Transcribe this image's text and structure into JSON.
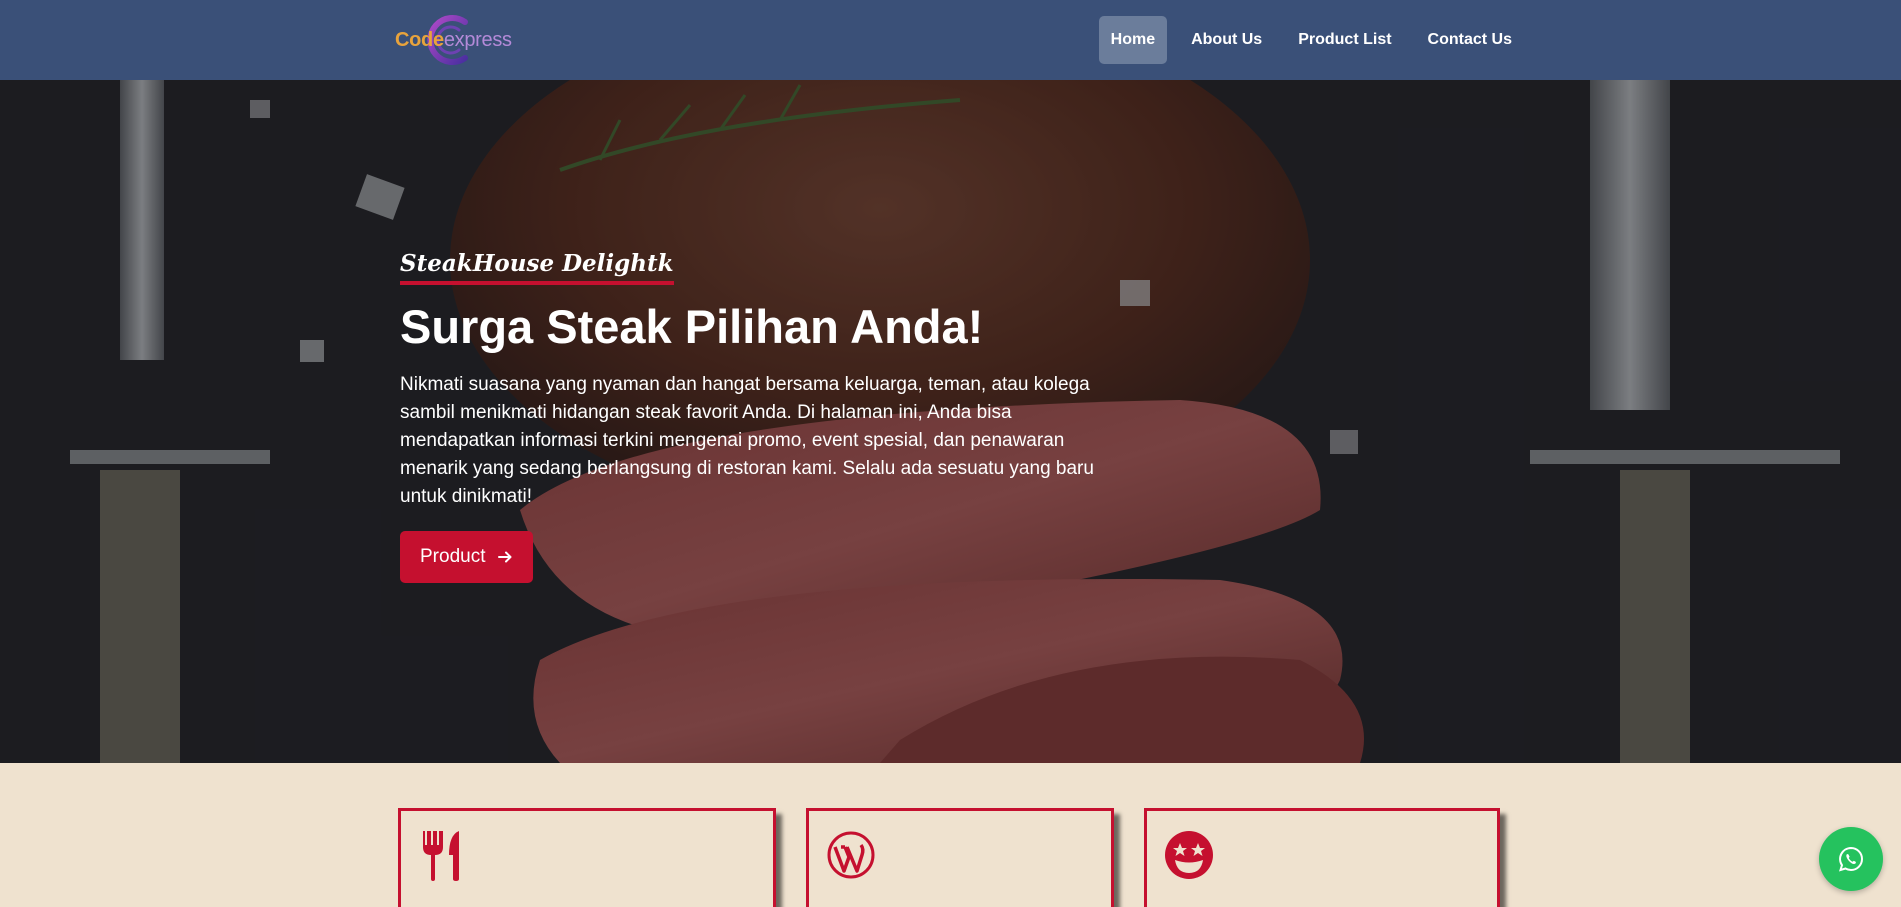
{
  "header": {
    "logo": {
      "part1": "Code",
      "part2": "express"
    },
    "nav": [
      {
        "label": "Home",
        "active": true
      },
      {
        "label": "About Us",
        "active": false
      },
      {
        "label": "Product List",
        "active": false
      },
      {
        "label": "Contact Us",
        "active": false
      }
    ]
  },
  "hero": {
    "brand": "SteakHouse Delightk",
    "title": "Surga Steak Pilihan Anda!",
    "description": "Nikmati suasana yang nyaman dan hangat bersama keluarga, teman, atau kolega sambil menikmati hidangan steak favorit Anda. Di halaman ini, Anda bisa mendapatkan informasi terkini mengenai promo, event spesial, dan penawaran menarik yang sedang berlangsung di restoran kami. Selalu ada sesuatu yang baru untuk dinikmati!",
    "button_label": "Product",
    "button_icon": "arrow-right-icon"
  },
  "features": [
    {
      "icon": "utensils-icon"
    },
    {
      "icon": "wordpress-icon"
    },
    {
      "icon": "grin-stars-icon"
    }
  ],
  "whatsapp": {
    "icon": "whatsapp-icon"
  },
  "colors": {
    "navbar": "#3a5078",
    "accent": "#c5102f",
    "features_bg": "#efe2cf",
    "whatsapp": "#25c25e"
  }
}
